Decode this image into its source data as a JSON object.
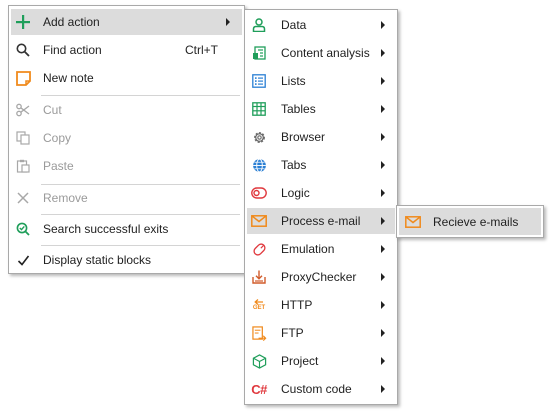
{
  "main_menu": {
    "items": [
      {
        "label": "Add action",
        "icon": "plus-icon",
        "enabled": true,
        "submenu": true
      },
      {
        "label": "Find action",
        "icon": "magnifier-icon",
        "shortcut": "Ctrl+T",
        "enabled": true
      },
      {
        "label": "New note",
        "icon": "note-icon",
        "enabled": true
      },
      {
        "label": "Cut",
        "icon": "scissors-icon",
        "enabled": false
      },
      {
        "label": "Copy",
        "icon": "copy-icon",
        "enabled": false
      },
      {
        "label": "Paste",
        "icon": "paste-icon",
        "enabled": false
      },
      {
        "label": "Remove",
        "icon": "close-icon",
        "enabled": false
      },
      {
        "label": "Search successful exits",
        "icon": "search-exits-icon",
        "enabled": true
      },
      {
        "label": "Display static blocks",
        "icon": "checkmark-icon",
        "checked": true,
        "enabled": true
      }
    ],
    "highlighted": "Add action"
  },
  "action_submenu": {
    "items": [
      {
        "label": "Data",
        "icon": "person-icon"
      },
      {
        "label": "Content analysis",
        "icon": "content-analysis-icon"
      },
      {
        "label": "Lists",
        "icon": "list-icon"
      },
      {
        "label": "Tables",
        "icon": "table-icon"
      },
      {
        "label": "Browser",
        "icon": "gear-icon"
      },
      {
        "label": "Tabs",
        "icon": "globe-icon"
      },
      {
        "label": "Logic",
        "icon": "toggle-icon"
      },
      {
        "label": "Process e-mail",
        "icon": "envelope-icon"
      },
      {
        "label": "Emulation",
        "icon": "mouse-icon"
      },
      {
        "label": "ProxyChecker",
        "icon": "download-box-icon"
      },
      {
        "label": "HTTP",
        "icon": "http-get-icon"
      },
      {
        "label": "FTP",
        "icon": "ftp-icon"
      },
      {
        "label": "Project",
        "icon": "cube-icon"
      },
      {
        "label": "Custom code",
        "icon": "csharp-icon"
      }
    ],
    "highlighted": "Process e-mail",
    "icon_labels": {
      "http": "GET",
      "csharp": "C#"
    }
  },
  "email_submenu": {
    "items": [
      {
        "label": "Recieve e-mails",
        "icon": "envelope-icon"
      }
    ]
  },
  "colors": {
    "highlight": "#dcdcdc",
    "green": "#1f9e5a",
    "orange": "#f08a1c",
    "blue": "#2a7fd4",
    "red": "#e0393e"
  }
}
